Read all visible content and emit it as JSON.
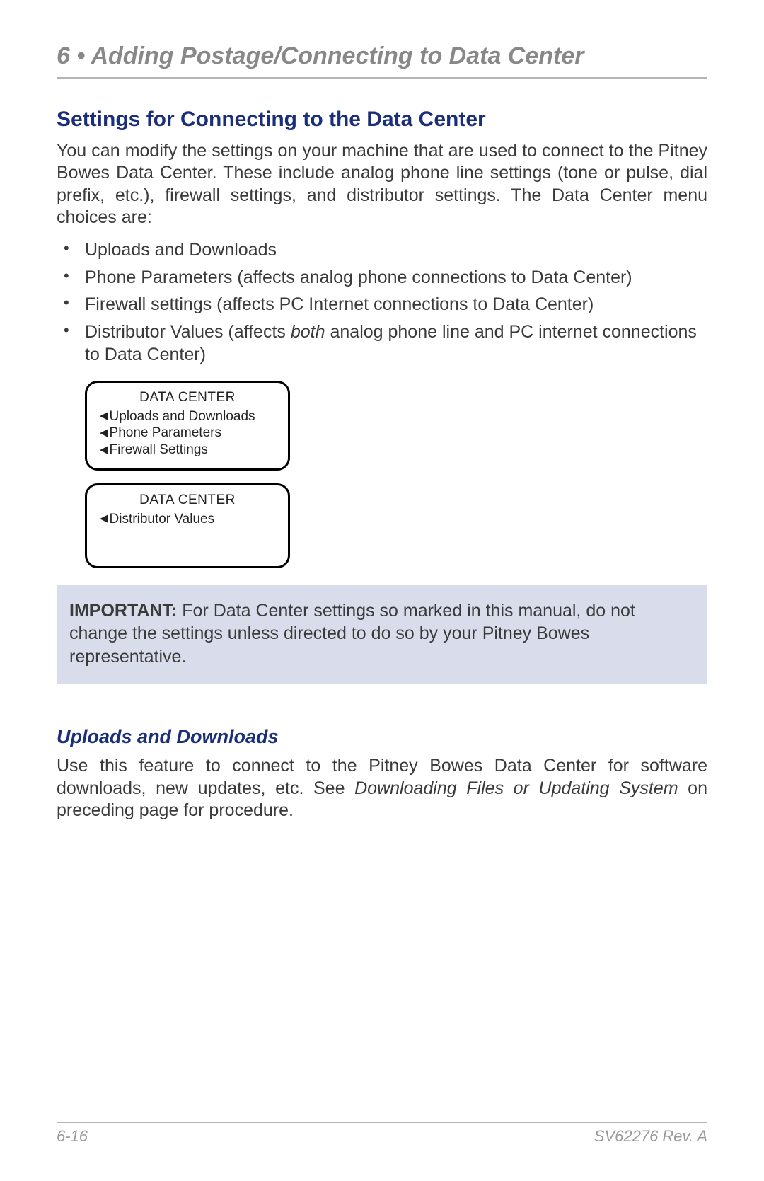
{
  "chapter": {
    "number": "6",
    "separator": "•",
    "title": "Adding Postage/Connecting to Data Center"
  },
  "section": {
    "heading": "Settings for Connecting to the Data Center",
    "intro": "You can modify the settings on your machine that are used to connect to the Pitney Bowes Data Center. These include analog phone line settings (tone or pulse, dial prefix, etc.), firewall settings, and distributor settings. The Data Center menu choices are:",
    "bullets": {
      "item0": "Uploads and Downloads",
      "item1": "Phone Parameters (affects analog phone connections to Data Center)",
      "item2": "Firewall settings (affects PC Internet connections to Data Center)",
      "item3_pre": "Distributor Values (affects ",
      "item3_em": "both",
      "item3_post": " analog phone line and PC internet connections to Data Center)"
    }
  },
  "screens": {
    "box1": {
      "title": "DATA CENTER",
      "items": {
        "i0": "Uploads and Downloads",
        "i1": "Phone Parameters",
        "i2": "Firewall Settings"
      }
    },
    "box2": {
      "title": "DATA CENTER",
      "items": {
        "i0": "Distributor Values"
      }
    }
  },
  "important": {
    "label": "IMPORTANT:",
    "text": " For Data Center settings so marked in this manual, do not change the settings unless directed to do so by your Pitney Bowes representative."
  },
  "subsection": {
    "heading": "Uploads and Downloads",
    "body_pre": "Use this feature to connect to the Pitney Bowes Data Center for software downloads, new updates, etc. See ",
    "body_em": "Downloading Files or Updating System",
    "body_post": " on preceding page for procedure."
  },
  "footer": {
    "page": "6-16",
    "docrev": "SV62276 Rev. A"
  }
}
